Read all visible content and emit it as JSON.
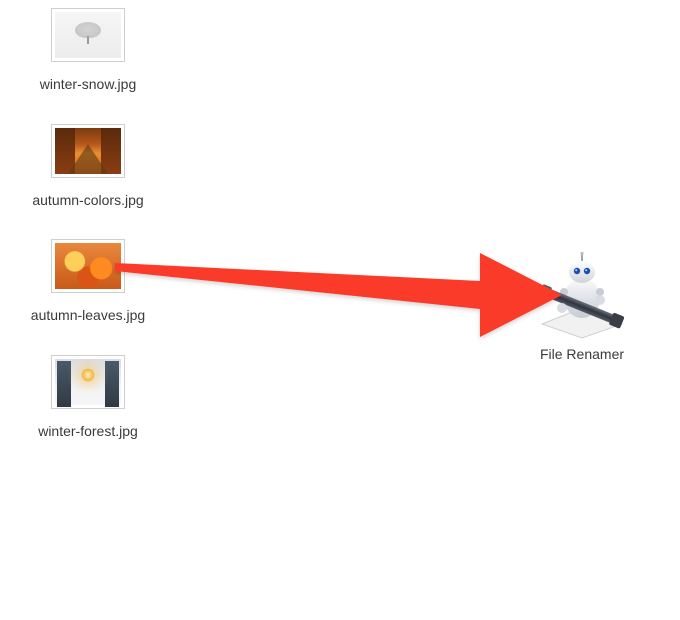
{
  "files": [
    {
      "name": "winter-snow.jpg"
    },
    {
      "name": "autumn-colors.jpg"
    },
    {
      "name": "autumn-leaves.jpg"
    },
    {
      "name": "winter-forest.jpg"
    }
  ],
  "app": {
    "name": "File Renamer"
  },
  "arrow_color": "#fb3b2a"
}
